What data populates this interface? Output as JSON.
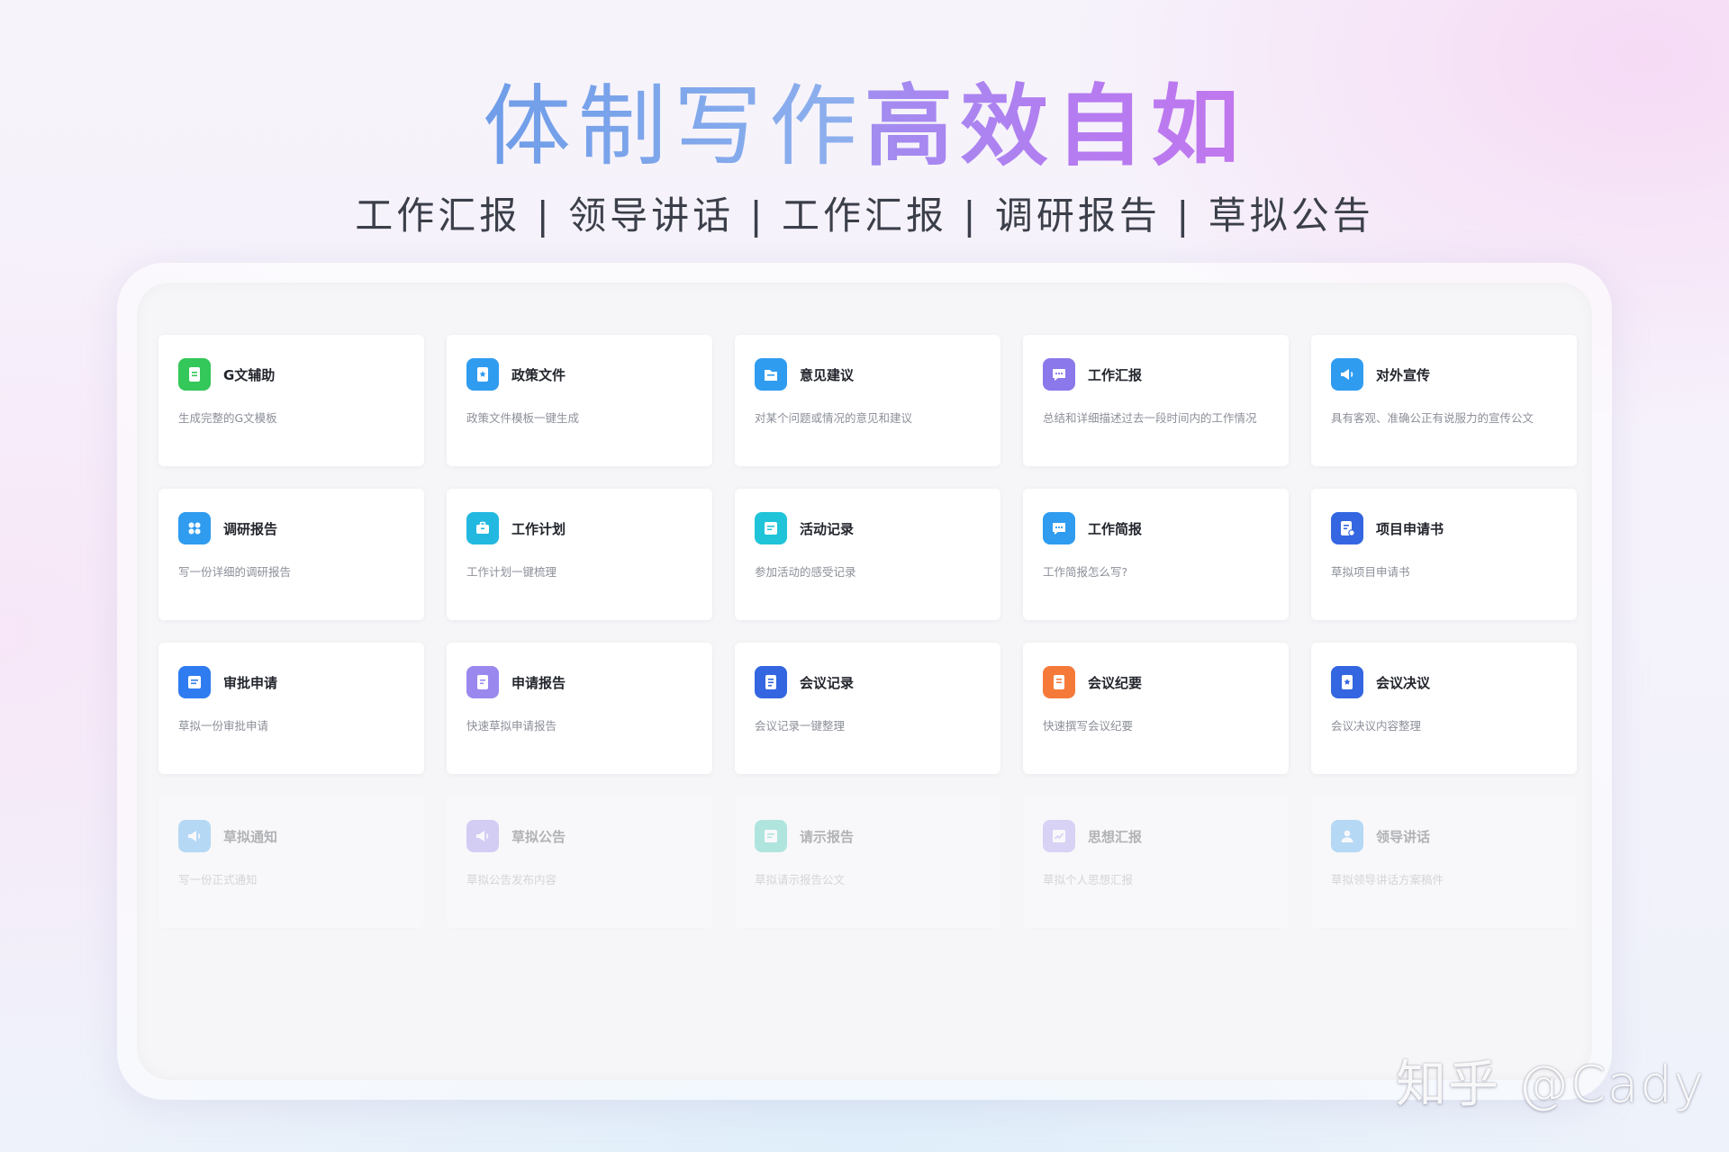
{
  "hero": {
    "title_light": "体制写作",
    "title_bold": "高效自如",
    "subtitle": "工作汇报 | 领导讲话 | 工作汇报 | 调研报告 | 草拟公告"
  },
  "cards": [
    {
      "title": "G文辅助",
      "desc": "生成完整的G文模板",
      "icon": "document-icon",
      "color": "#34c759"
    },
    {
      "title": "政策文件",
      "desc": "政策文件模板一键生成",
      "icon": "star-document-icon",
      "color": "#2f9cf0"
    },
    {
      "title": "意见建议",
      "desc": "对某个问题或情况的意见和建议",
      "icon": "folder-icon",
      "color": "#2f9cf0"
    },
    {
      "title": "工作汇报",
      "desc": "总结和详细描述过去一段时间内的工作情况",
      "icon": "chat-icon",
      "color": "#8b78ea"
    },
    {
      "title": "对外宣传",
      "desc": "具有客观、准确公正有说服力的宣传公文",
      "icon": "speaker-icon",
      "color": "#2f9cf0"
    },
    {
      "title": "调研报告",
      "desc": "写一份详细的调研报告",
      "icon": "grid-icon",
      "color": "#2f9cf0"
    },
    {
      "title": "工作计划",
      "desc": "工作计划一键梳理",
      "icon": "briefcase-icon",
      "color": "#22b8e0"
    },
    {
      "title": "活动记录",
      "desc": "参加活动的感受记录",
      "icon": "note-icon",
      "color": "#1fc4d8"
    },
    {
      "title": "工作简报",
      "desc": "工作简报怎么写?",
      "icon": "chat-icon",
      "color": "#2f9cf0"
    },
    {
      "title": "项目申请书",
      "desc": "草拟项目申请书",
      "icon": "application-icon",
      "color": "#3366e0"
    },
    {
      "title": "审批申请",
      "desc": "草拟一份审批申请",
      "icon": "approval-icon",
      "color": "#2f7cf0"
    },
    {
      "title": "申请报告",
      "desc": "快速草拟申请报告",
      "icon": "report-icon",
      "color": "#9a88ef"
    },
    {
      "title": "会议记录",
      "desc": "会议记录一键整理",
      "icon": "meeting-icon",
      "color": "#3366e0"
    },
    {
      "title": "会议纪要",
      "desc": "快速撰写会议纪要",
      "icon": "minutes-icon",
      "color": "#f57a3a"
    },
    {
      "title": "会议决议",
      "desc": "会议决议内容整理",
      "icon": "star-document-icon",
      "color": "#3366e0"
    },
    {
      "title": "草拟通知",
      "desc": "写一份正式通知",
      "icon": "speaker-icon",
      "color": "#2f9cf0",
      "faded": true
    },
    {
      "title": "草拟公告",
      "desc": "草拟公告发布内容",
      "icon": "speaker-icon",
      "color": "#8b78ea",
      "faded": true
    },
    {
      "title": "请示报告",
      "desc": "草拟请示报告公文",
      "icon": "note-icon",
      "color": "#1fc4a8",
      "faded": true
    },
    {
      "title": "思想汇报",
      "desc": "草拟个人思想汇报",
      "icon": "chart-icon",
      "color": "#9a88ef",
      "faded": true
    },
    {
      "title": "领导讲话",
      "desc": "草拟领导讲话方案稿件",
      "icon": "person-icon",
      "color": "#2f9cf0",
      "faded": true
    }
  ],
  "watermark": "知乎 @Cady"
}
